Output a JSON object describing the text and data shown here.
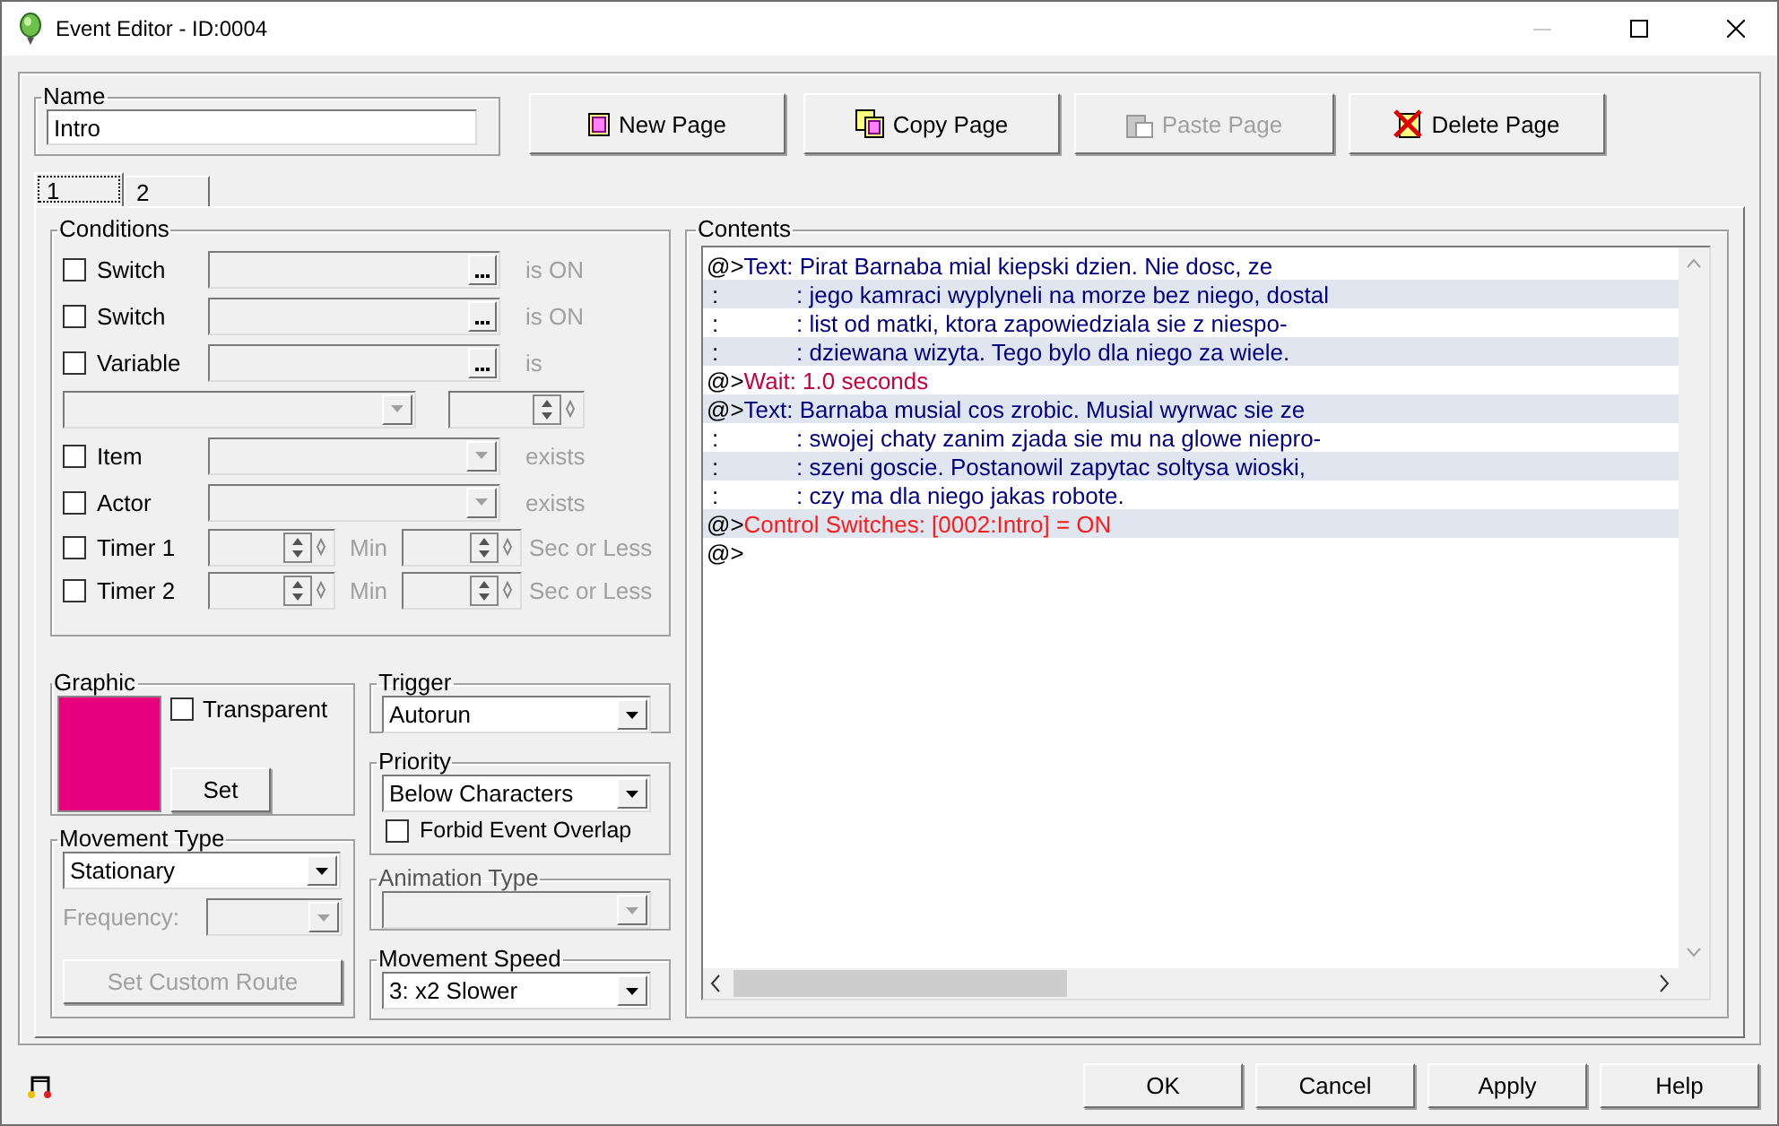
{
  "window": {
    "title": "Event Editor - ID:0004"
  },
  "name": {
    "label": "Name",
    "value": "Intro"
  },
  "page_buttons": [
    {
      "kind": "new",
      "label": "New Page",
      "disabled": false
    },
    {
      "kind": "copy",
      "label": "Copy Page",
      "disabled": false
    },
    {
      "kind": "paste",
      "label": "Paste Page",
      "disabled": true
    },
    {
      "kind": "delete",
      "label": "Delete Page",
      "disabled": false
    }
  ],
  "tabs": [
    {
      "label": "1",
      "selected": true
    },
    {
      "label": "2",
      "selected": false
    }
  ],
  "conditions": {
    "label": "Conditions",
    "rows": [
      {
        "kind": "picker",
        "label": "Switch",
        "checked": false,
        "suffix": "is ON"
      },
      {
        "kind": "picker",
        "label": "Switch",
        "checked": false,
        "suffix": "is ON"
      },
      {
        "kind": "picker",
        "label": "Variable",
        "checked": false,
        "suffix": "is"
      },
      {
        "kind": "compare"
      },
      {
        "kind": "dropdown",
        "label": "Item",
        "checked": false,
        "suffix": "exists"
      },
      {
        "kind": "dropdown",
        "label": "Actor",
        "checked": false,
        "suffix": "exists"
      },
      {
        "kind": "timer",
        "label": "Timer 1",
        "checked": false,
        "unit": "Min",
        "suffix": "Sec or Less"
      },
      {
        "kind": "timer",
        "label": "Timer 2",
        "checked": false,
        "unit": "Min",
        "suffix": "Sec or Less"
      }
    ]
  },
  "graphic": {
    "label": "Graphic",
    "color": "#e6007e",
    "transparent_label": "Transparent",
    "transparent": false,
    "set_button": "Set"
  },
  "movement_type": {
    "label": "Movement Type",
    "value": "Stationary",
    "frequency_label": "Frequency:",
    "route_button": "Set Custom Route"
  },
  "trigger": {
    "label": "Trigger",
    "value": "Autorun"
  },
  "priority": {
    "label": "Priority",
    "value": "Below Characters",
    "overlap_label": "Forbid Event Overlap",
    "overlap": false
  },
  "animation_type": {
    "label": "Animation Type"
  },
  "movement_speed": {
    "label": "Movement Speed",
    "value": "3: x2 Slower"
  },
  "contents": {
    "label": "Contents",
    "lines": [
      {
        "kind": "text",
        "marker": "@>",
        "text": "Text: Pirat Barnaba mial kiepski dzien. Nie dosc, ze"
      },
      {
        "kind": "text",
        "marker": ":",
        "text": ": jego kamraci wyplyneli na morze bez niego, dostal"
      },
      {
        "kind": "text",
        "marker": ":",
        "text": ": list od matki, ktora zapowiedziala sie z niespo-"
      },
      {
        "kind": "text",
        "marker": ":",
        "text": ": dziewana wizyta. Tego bylo dla niego za wiele."
      },
      {
        "kind": "wait",
        "marker": "@>",
        "text": "Wait: 1.0 seconds"
      },
      {
        "kind": "text",
        "marker": "@>",
        "text": "Text: Barnaba musial cos zrobic. Musial wyrwac sie ze"
      },
      {
        "kind": "text",
        "marker": ":",
        "text": ": swojej chaty zanim zjada sie mu na glowe niepro-"
      },
      {
        "kind": "text",
        "marker": ":",
        "text": ": szeni goscie. Postanowil zapytac soltysa wioski,"
      },
      {
        "kind": "text",
        "marker": ":",
        "text": ": czy ma dla niego jakas robote."
      },
      {
        "kind": "switch",
        "marker": "@>",
        "text": "Control Switches: [0002:Intro] = ON"
      },
      {
        "kind": "empty",
        "marker": "@>"
      }
    ]
  },
  "dialog_buttons": [
    "OK",
    "Cancel",
    "Apply",
    "Help"
  ]
}
